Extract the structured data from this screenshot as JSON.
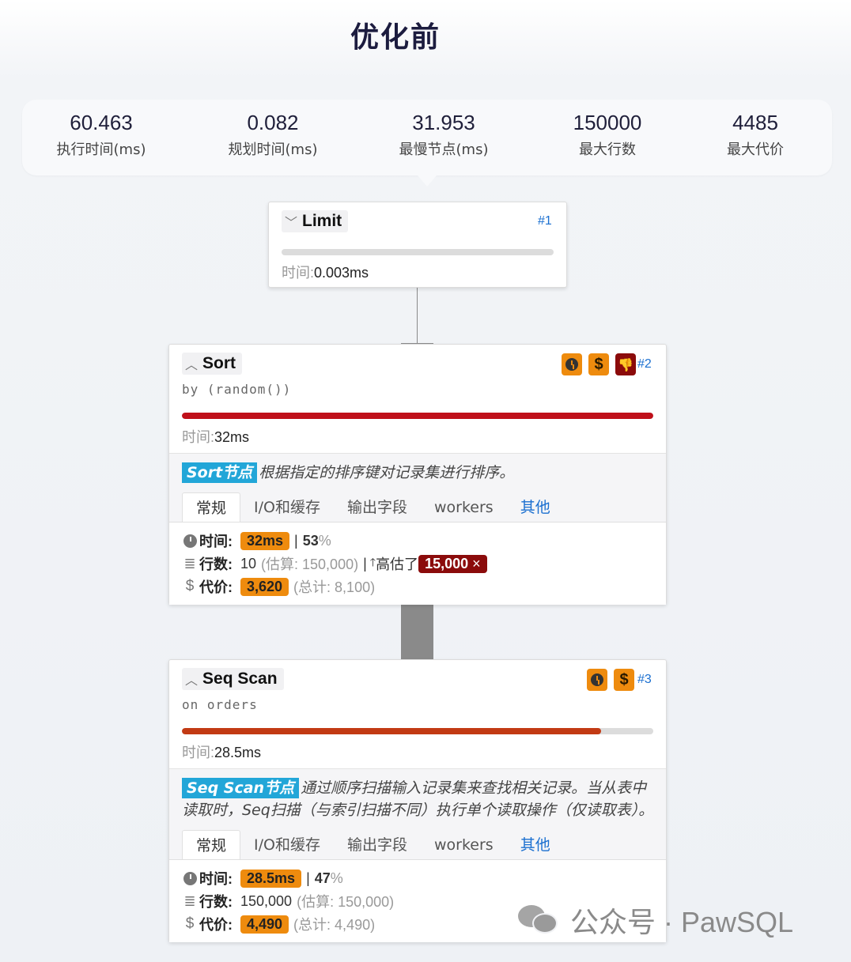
{
  "page_title": "优化前",
  "stats": [
    {
      "value": "60.463",
      "label": "执行时间(ms)"
    },
    {
      "value": "0.082",
      "label": "规划时间(ms)"
    },
    {
      "value": "31.953",
      "label": "最慢节点(ms)"
    },
    {
      "value": "150000",
      "label": "最大行数"
    },
    {
      "value": "4485",
      "label": "最大代价"
    }
  ],
  "nodes": {
    "limit": {
      "title": "Limit",
      "id": "#1",
      "time_key": "时间:",
      "time_val": "0.003ms",
      "progress_fraction": 0.0
    },
    "sort": {
      "title": "Sort",
      "id": "#2",
      "subtitle": "by (random())",
      "time_key": "时间:",
      "time_val": "32ms",
      "progress_fraction": 1.0,
      "bar_color": "#c0101a",
      "badges": [
        "clock-icon",
        "dollar-icon",
        "thumbs-down-icon"
      ],
      "tag": "Sort节点",
      "desc": "根据指定的排序键对记录集进行排序。",
      "tabs": [
        "常规",
        "I/O和缓存",
        "输出字段",
        "workers",
        "其他"
      ],
      "time_label": "时间:",
      "time_pill": "32ms",
      "time_sep": "|",
      "time_pct": "53",
      "time_pct_unit": "%",
      "rows_label": "行数:",
      "rows_val": "10",
      "rows_est": "(估算: 150,000)",
      "rows_sep": "|",
      "rows_arrow": "🡑",
      "rows_over": "高估了",
      "rows_pill": "15,000",
      "rows_x": "×",
      "cost_label": "代价:",
      "cost_pill": "3,620",
      "cost_total": "(总计: 8,100)"
    },
    "seqscan": {
      "title": "Seq Scan",
      "id": "#3",
      "subtitle": "on orders",
      "time_key": "时间:",
      "time_val": "28.5ms",
      "progress_fraction": 0.89,
      "bar_color": "#c23a14",
      "badges": [
        "clock-icon",
        "dollar-icon"
      ],
      "tag": "Seq Scan节点",
      "desc": "通过顺序扫描输入记录集来查找相关记录。当从表中读取时，Seq扫描（与索引扫描不同）执行单个读取操作（仅读取表）。",
      "tabs": [
        "常规",
        "I/O和缓存",
        "输出字段",
        "workers",
        "其他"
      ],
      "time_label": "时间:",
      "time_pill": "28.5ms",
      "time_sep": "|",
      "time_pct": "47",
      "time_pct_unit": "%",
      "rows_label": "行数:",
      "rows_val": "150,000",
      "rows_est": "(估算: 150,000)",
      "cost_label": "代价:",
      "cost_pill": "4,490",
      "cost_total": "(总计: 4,490)"
    }
  },
  "icons": {
    "dollar": "$",
    "thumb_down": "👎",
    "lines": "≣",
    "chevron_down": "﹀",
    "chevron_up": "︿"
  },
  "watermark": {
    "text": "公众号 · PawSQL"
  },
  "colors": {
    "accent_orange": "#ee8b0e",
    "dark_red": "#8b0b0b",
    "link_blue": "#1a6fd0",
    "tag_blue": "#22a6d8"
  }
}
